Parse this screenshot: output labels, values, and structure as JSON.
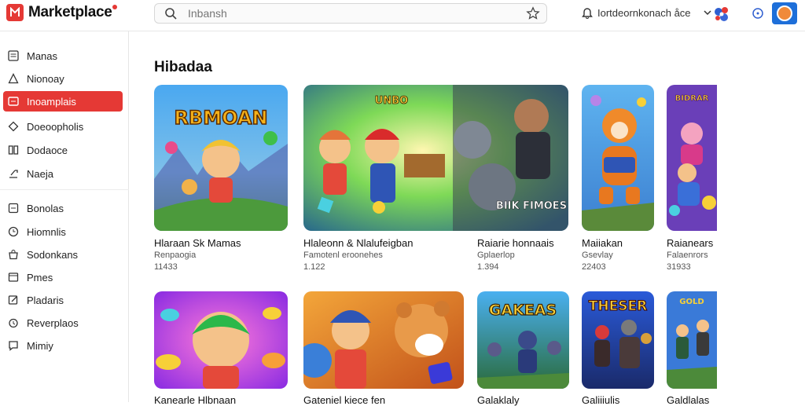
{
  "header": {
    "app_title": "Marketplace",
    "search_placeholder": "Inbansh",
    "user_label": "Iortdeornkonach åce"
  },
  "sidebar": {
    "items": [
      {
        "label": "Manas",
        "icon": "list-icon",
        "active": false
      },
      {
        "label": "Nionoay",
        "icon": "home-icon",
        "active": false
      },
      {
        "label": "Inoamplais",
        "icon": "grid-icon",
        "active": true
      },
      {
        "label": "Doeoopholis",
        "icon": "tag-icon",
        "active": false
      },
      {
        "label": "Dodaoce",
        "icon": "book-icon",
        "active": false
      },
      {
        "label": "Naeja",
        "icon": "share-icon",
        "active": false
      },
      {
        "label": "Bonolas",
        "icon": "box-icon",
        "active": false
      },
      {
        "label": "Hiomnlis",
        "icon": "clock-icon",
        "active": false
      },
      {
        "label": "Sodonkans",
        "icon": "bag-icon",
        "active": false
      },
      {
        "label": "Pmes",
        "icon": "folder-icon",
        "active": false
      },
      {
        "label": "Pladaris",
        "icon": "edit-icon",
        "active": false
      },
      {
        "label": "Reverplaos",
        "icon": "history-icon",
        "active": false
      },
      {
        "label": "Mimiy",
        "icon": "chat-icon",
        "active": false
      }
    ]
  },
  "main": {
    "section_title": "Hibadaa",
    "row1": [
      {
        "title": "Hlaraan Sk Mamas",
        "subtitle": "Renpaogia",
        "count": "11433",
        "art_text": "RBMOAN"
      },
      {
        "title": "Hlaleonn & Nlalufeigban",
        "subtitle": "Famotenl eroonehes",
        "count": "1.122",
        "art_text": "BIIK FIMOES"
      },
      {
        "title": "Raiarie honnaais",
        "subtitle": "Gplaerlop",
        "count": "1.394",
        "art_text": ""
      },
      {
        "title": "Maiiakan",
        "subtitle": "Gsevlay",
        "count": "22403",
        "art_text": ""
      },
      {
        "title": "Raianears",
        "subtitle": "Falaenrors",
        "count": "31933",
        "art_text": "BIDRAR"
      }
    ],
    "row2": [
      {
        "title": "Kanearle Hlbnaan",
        "art_text": ""
      },
      {
        "title": "Gateniel kiece fen",
        "art_text": ""
      },
      {
        "title": "Galaklaly",
        "art_text": "GAKEAS"
      },
      {
        "title": "Galiiiulis",
        "art_text": "THESER"
      },
      {
        "title": "Galdlalas",
        "art_text": ""
      }
    ]
  }
}
